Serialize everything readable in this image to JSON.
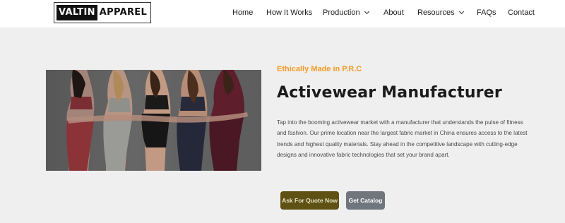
{
  "logo": {
    "part1": "VALTIN",
    "part2": "APPAREL"
  },
  "nav": {
    "items": [
      {
        "label": "Home"
      },
      {
        "label": "How It Works"
      },
      {
        "label": "Production"
      },
      {
        "label": "About"
      },
      {
        "label": "Resources"
      },
      {
        "label": "FAQs"
      },
      {
        "label": "Contact"
      }
    ]
  },
  "hero": {
    "tagline": "Ethically Made in P.R.C",
    "title": "Activewear Manufacturer",
    "description": "Tap into the booming activewear market with a manufacturer that understands the pulse of fitness and fashion. Our prime location near the largest fabric market in China ensures access to the latest trends and highest quality materials. Stay ahead in the competitive landscape with cutting-edge designs and innovative fabric technologies that set your brand apart.",
    "quote_button": "Ask For Quote Now",
    "catalog_button": "Get Catalog"
  },
  "colors": {
    "accent": "#f59a23",
    "quote_button": "#5f5113",
    "catalog_button": "#70767e",
    "background": "#efefef"
  }
}
